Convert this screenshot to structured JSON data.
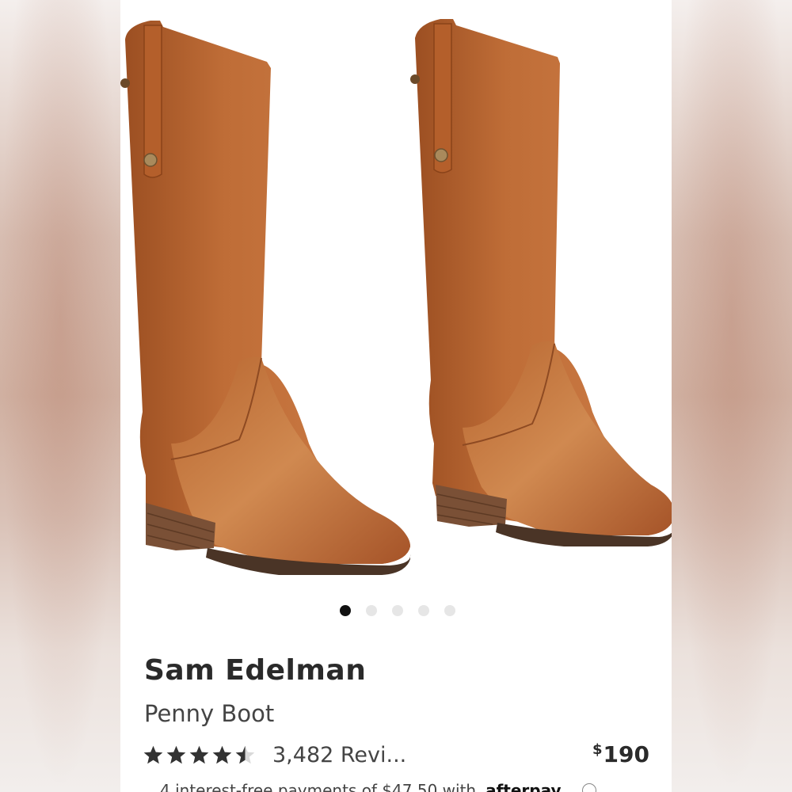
{
  "gallery": {
    "dot_count": 5,
    "active_index": 0
  },
  "product": {
    "brand": "Sam Edelman",
    "name": "Penny Boot",
    "rating": 4.5,
    "reviews_label": "3,482 Revi...",
    "price_currency": "$",
    "price_amount": "190"
  },
  "afterpay": {
    "text": "4 interest-free payments of $47.50 with",
    "logo": "afterpay"
  },
  "colors": {
    "leather": "#b5622c",
    "sole": "#4a3426",
    "star": "#333333"
  }
}
